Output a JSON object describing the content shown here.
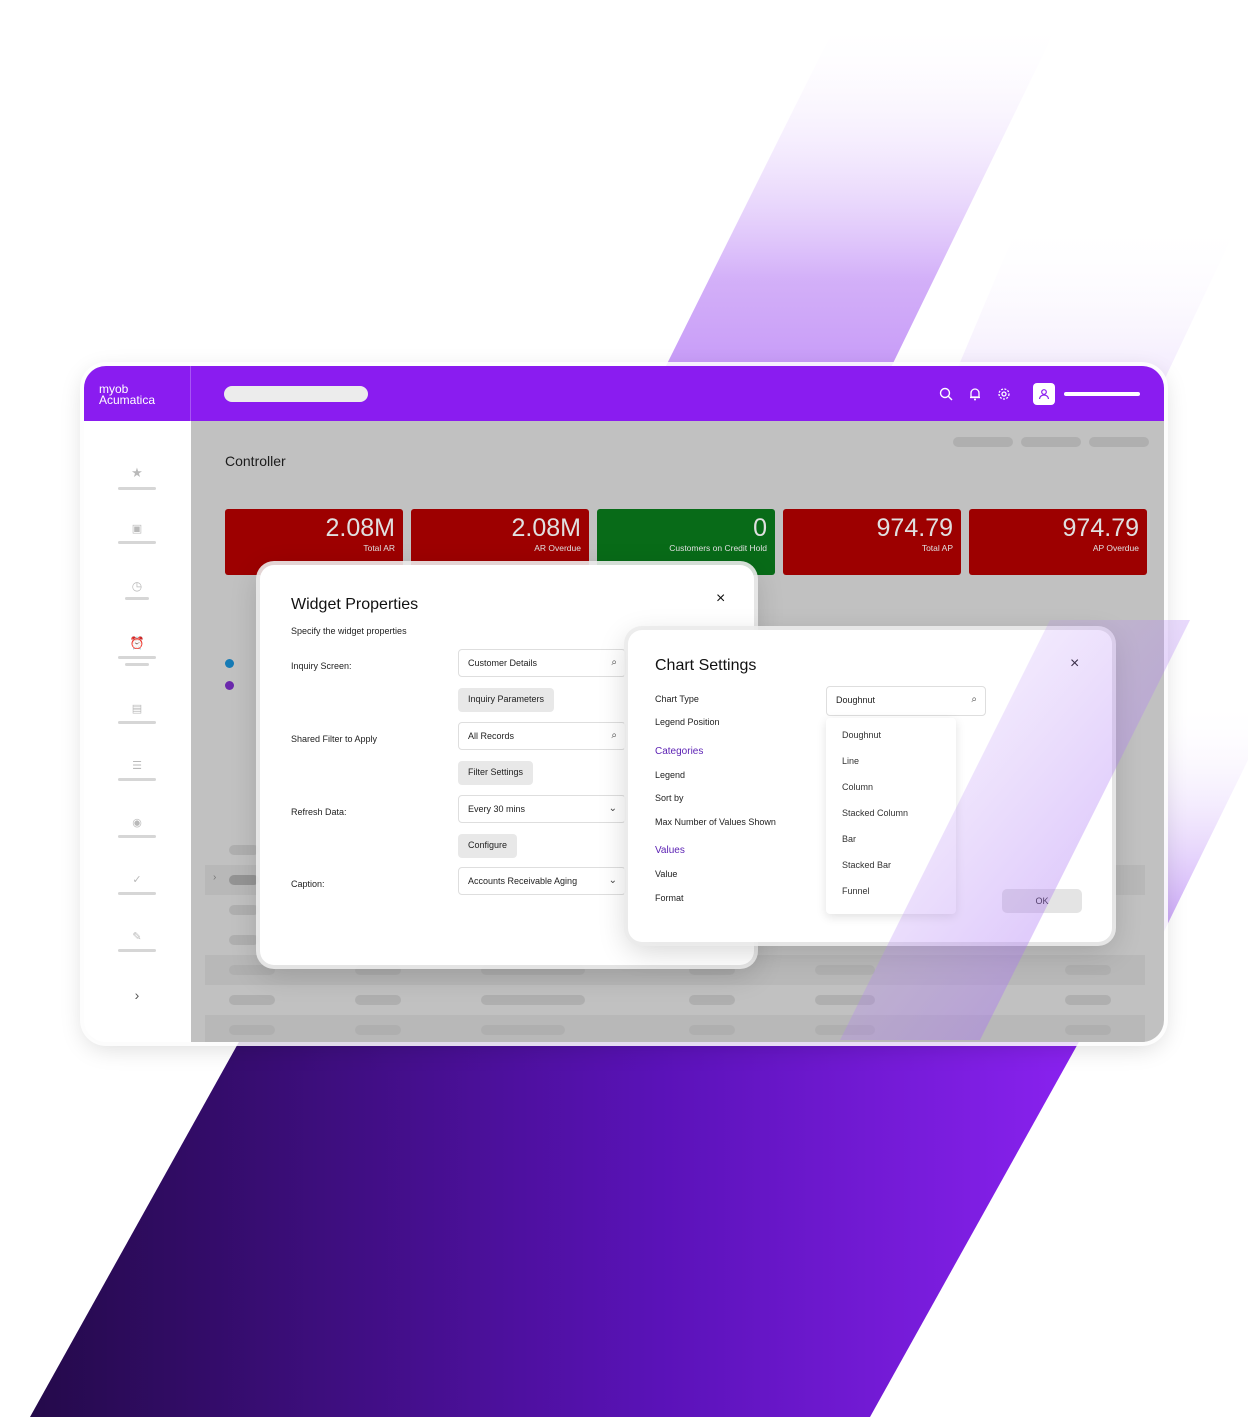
{
  "brand": {
    "line1": "myob",
    "line2": "Acumatica"
  },
  "page": {
    "title": "Controller"
  },
  "kpis": [
    {
      "value": "2.08M",
      "label": "Total AR",
      "status": "red"
    },
    {
      "value": "2.08M",
      "label": "AR Overdue",
      "status": "red"
    },
    {
      "value": "0",
      "label": "Customers on Credit Hold",
      "status": "green"
    },
    {
      "value": "974.79",
      "label": "Total AP",
      "status": "red"
    },
    {
      "value": "974.79",
      "label": "AP Overdue",
      "status": "red"
    }
  ],
  "widget_properties": {
    "title": "Widget Properties",
    "subtitle": "Specify the widget properties",
    "inquiry_screen_label": "Inquiry Screen:",
    "inquiry_screen_value": "Customer Details",
    "inquiry_parameters_button": "Inquiry Parameters",
    "shared_filter_label": "Shared Filter to Apply",
    "shared_filter_value": "All Records",
    "filter_settings_button": "Filter Settings",
    "refresh_label": "Refresh Data:",
    "refresh_value": "Every 30 mins",
    "configure_button": "Configure",
    "caption_label": "Caption:",
    "caption_value": "Accounts Receivable Aging",
    "close": "×"
  },
  "chart_settings": {
    "title": "Chart Settings",
    "chart_type_label": "Chart Type",
    "legend_position_label": "Legend Position",
    "categories_section": "Categories",
    "legend_label": "Legend",
    "sort_by_label": "Sort by",
    "max_values_label": "Max Number of Values Shown",
    "values_section": "Values",
    "value_label": "Value",
    "format_label": "Format",
    "chart_type_value": "Doughnut",
    "options": [
      "Doughnut",
      "Line",
      "Column",
      "Stacked Column",
      "Bar",
      "Stacked Bar",
      "Funnel"
    ],
    "ok_button": "OK",
    "close": "×"
  },
  "colors": {
    "brand_purple": "#8a1cf0",
    "kpi_red": "#b30000",
    "kpi_green": "#0a7a1c",
    "section_purple": "#5a1fb3"
  }
}
